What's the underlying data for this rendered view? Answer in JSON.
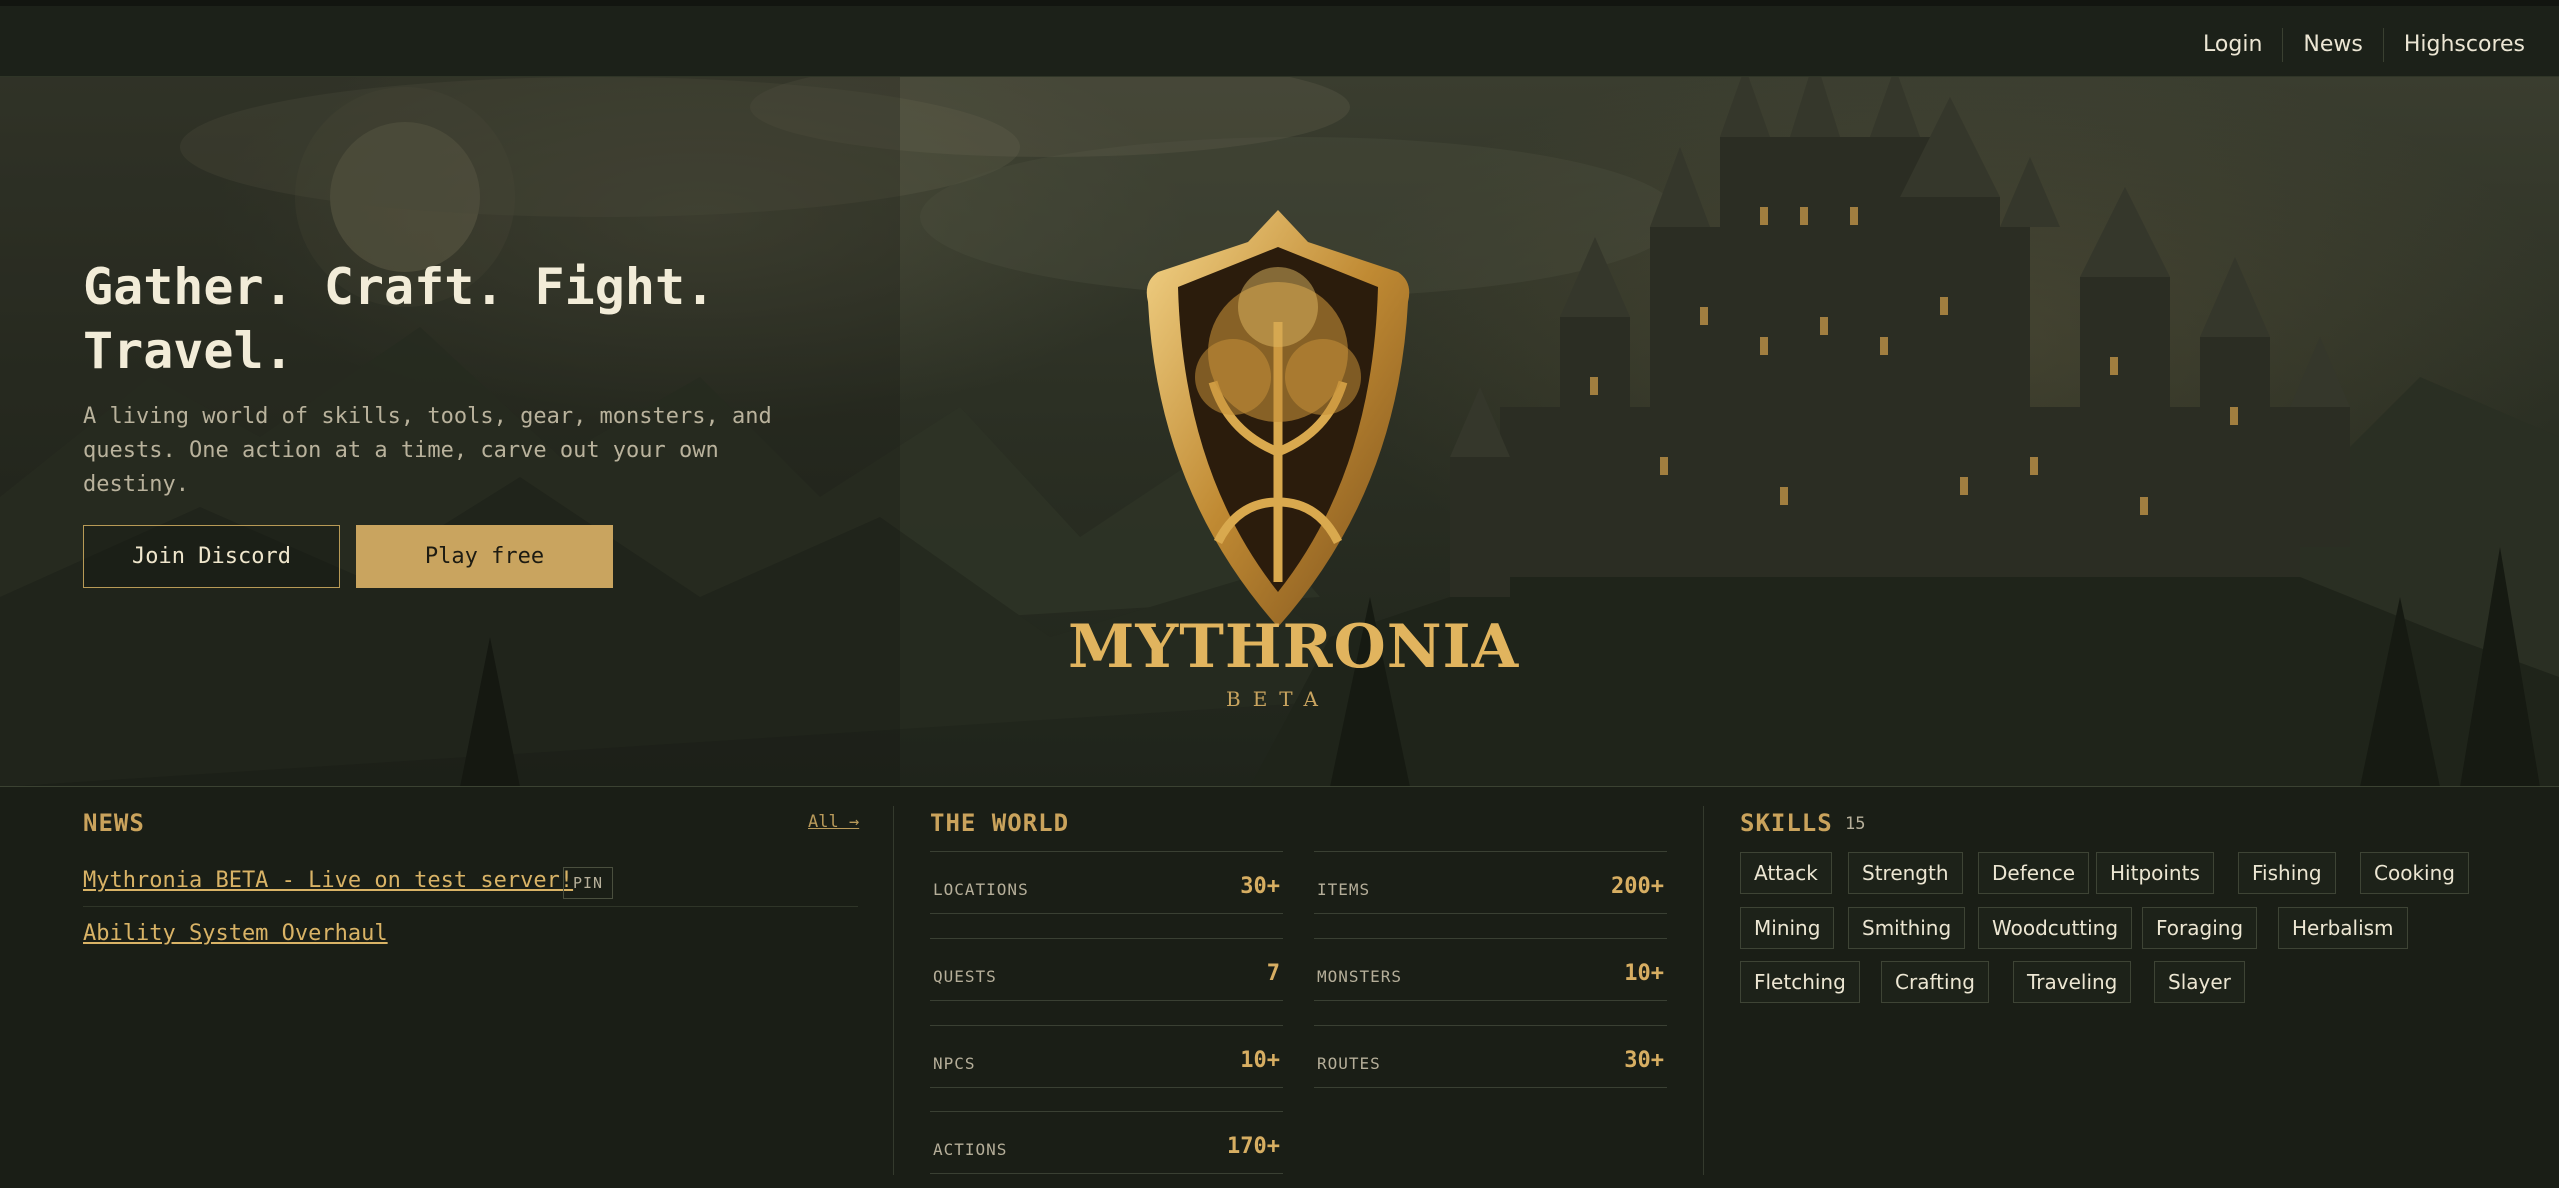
{
  "nav": {
    "items": [
      "Login",
      "News",
      "Highscores"
    ]
  },
  "hero": {
    "title": "Gather. Craft. Fight. Travel.",
    "subtitle": "A living world of skills, tools, gear, monsters, and quests. One action at a time, carve out your own destiny.",
    "discord_button": "Join Discord",
    "play_button": "Play free",
    "logo_name": "MYTHRONIA",
    "logo_tag": "BETA"
  },
  "news": {
    "title": "NEWS",
    "all_link": "All →",
    "items": [
      {
        "title": "Mythronia BETA - Live on test server!",
        "badge": "PIN"
      },
      {
        "title": "Ability System Overhaul"
      }
    ]
  },
  "world": {
    "title": "THE WORLD",
    "stats": [
      {
        "label": "LOCATIONS",
        "value": "30+"
      },
      {
        "label": "ITEMS",
        "value": "200+"
      },
      {
        "label": "QUESTS",
        "value": "7"
      },
      {
        "label": "MONSTERS",
        "value": "10+"
      },
      {
        "label": "NPCS",
        "value": "10+"
      },
      {
        "label": "ROUTES",
        "value": "30+"
      },
      {
        "label": "ACTIONS",
        "value": "170+"
      }
    ]
  },
  "skills": {
    "title": "SKILLS",
    "count": "15",
    "items": [
      "Attack",
      "Strength",
      "Defence",
      "Hitpoints",
      "Fishing",
      "Cooking",
      "Mining",
      "Smithing",
      "Woodcutting",
      "Foraging",
      "Herbalism",
      "Fletching",
      "Crafting",
      "Traveling",
      "Slayer"
    ]
  },
  "colors": {
    "accent": "#c9a45f",
    "background": "#1a1e16",
    "gold_text": "#d7ae62"
  }
}
